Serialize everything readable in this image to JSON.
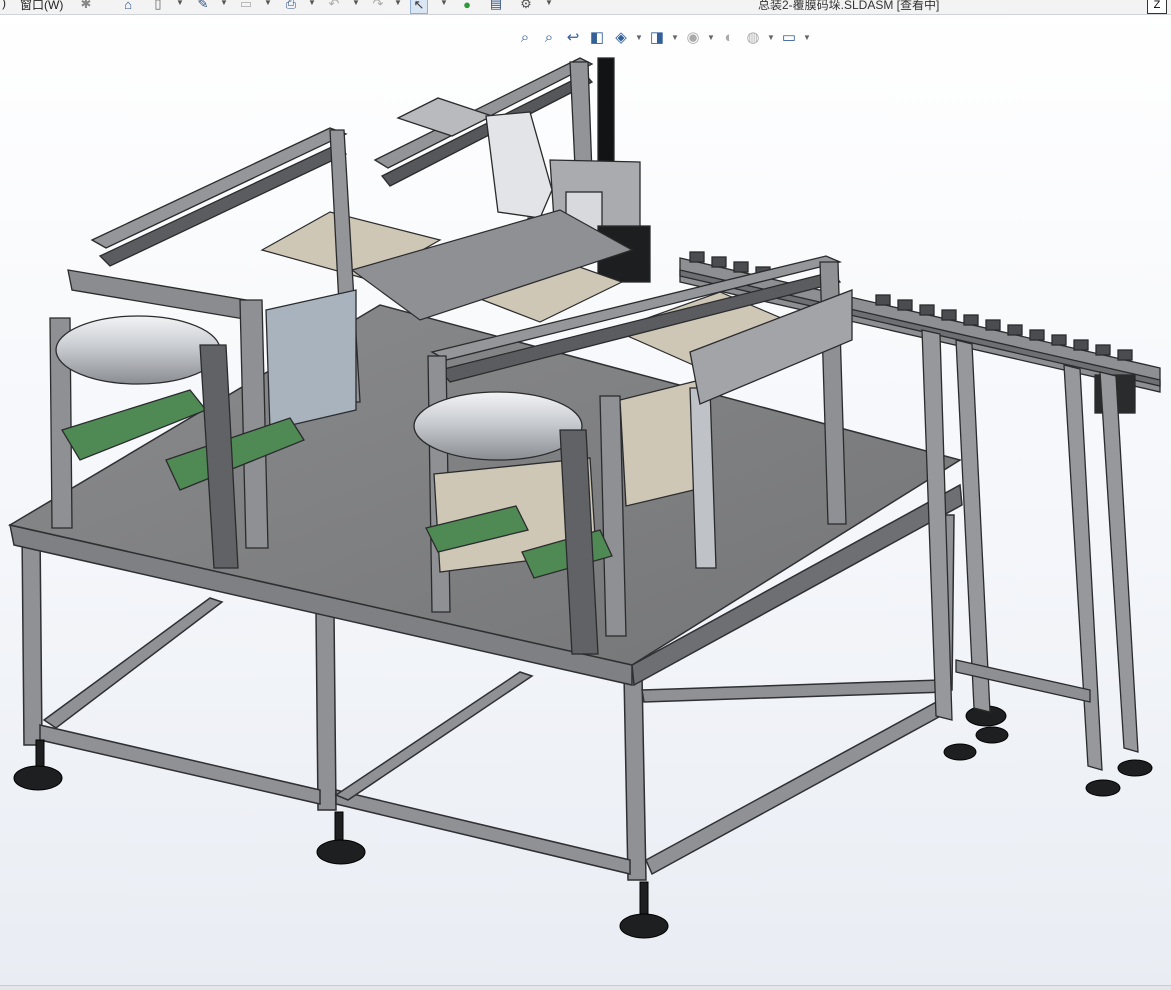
{
  "menu": {
    "partial_label": ")",
    "window_label": "窗口(W)"
  },
  "toolbar": {
    "items": [
      {
        "icon": "pin-icon",
        "glyph": "✱"
      },
      {
        "icon": "home-icon",
        "glyph": "⌂"
      },
      {
        "icon": "new-document-icon",
        "glyph": "▯"
      },
      {
        "icon": "open-document-icon",
        "glyph": "✎"
      },
      {
        "icon": "save-icon",
        "glyph": "▭"
      },
      {
        "icon": "print-icon",
        "glyph": "⎙"
      },
      {
        "icon": "undo-icon",
        "glyph": "↶"
      },
      {
        "icon": "redo-icon",
        "glyph": "↷"
      },
      {
        "icon": "select-cursor-icon",
        "glyph": "↖"
      },
      {
        "icon": "traffic-light-icon",
        "glyph": "●"
      },
      {
        "icon": "file-properties-icon",
        "glyph": "▤"
      },
      {
        "icon": "options-gear-icon",
        "glyph": "⚙"
      }
    ]
  },
  "window": {
    "title": "总装2-覆膜码垛.SLDASM [查看中]",
    "close_glyph": "Z"
  },
  "heads_up": {
    "buttons": [
      {
        "icon": "zoom-to-fit-icon",
        "glyph": "⌕"
      },
      {
        "icon": "zoom-to-area-icon",
        "glyph": "⌕"
      },
      {
        "icon": "previous-view-icon",
        "glyph": "↩"
      },
      {
        "icon": "section-view-icon",
        "glyph": "◧"
      },
      {
        "icon": "view-orientation-icon",
        "glyph": "◈"
      },
      {
        "icon": "display-style-icon",
        "glyph": "◨"
      },
      {
        "icon": "hide-show-items-icon",
        "glyph": "◉"
      },
      {
        "icon": "edit-appearance-icon",
        "glyph": "◐"
      },
      {
        "icon": "apply-scene-icon",
        "glyph": "◍"
      },
      {
        "icon": "view-settings-icon",
        "glyph": "▭"
      }
    ]
  },
  "colors": {
    "steel": "#8f9195",
    "steel_dark": "#55575b",
    "plate": "#7d7e80",
    "belt": "#4f8a55",
    "tray": "#cfc7b5",
    "roller": "#d7dadf"
  }
}
